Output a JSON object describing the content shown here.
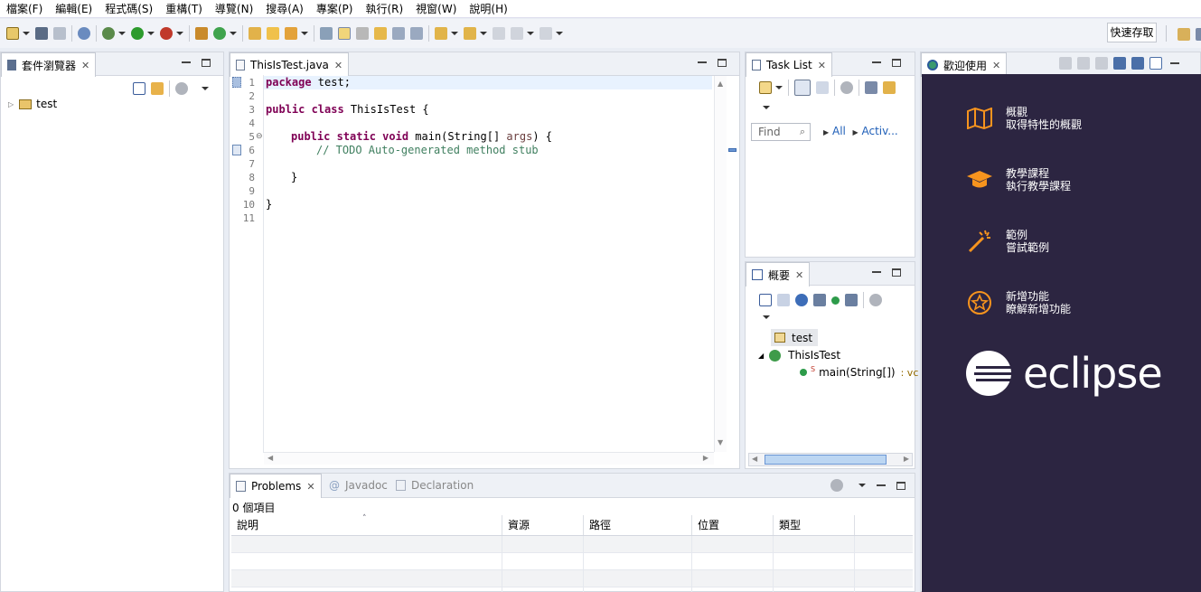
{
  "menu": [
    "檔案(F)",
    "編輯(E)",
    "程式碼(S)",
    "重構(T)",
    "導覽(N)",
    "搜尋(A)",
    "專案(P)",
    "執行(R)",
    "視窗(W)",
    "說明(H)"
  ],
  "toolbar": {
    "quick_access": "快速存取"
  },
  "package_explorer": {
    "title": "套件瀏覽器",
    "tree": [
      "test"
    ]
  },
  "editor": {
    "tab": "ThisIsTest.java",
    "lines": [
      "1",
      "2",
      "3",
      "4",
      "5",
      "6",
      "7",
      "8",
      "9",
      "10",
      "11"
    ],
    "code": {
      "l1_kw": "package",
      "l1_rest": " test;",
      "l3_kw": "public class",
      "l3_rest": " ThisIsTest {",
      "l5_kw": "public static void",
      "l5_rest": " main(String[] ",
      "l5_arg": "args",
      "l5_end": ") {",
      "l6_comment": "// TODO Auto-generated method stub",
      "l8": "}",
      "l10": "}"
    }
  },
  "task_list": {
    "title": "Task List",
    "find_placeholder": "Find",
    "all": "All",
    "activate": "Activ..."
  },
  "outline": {
    "title": "概要",
    "items": [
      "test",
      "ThisIsTest",
      "main(String[])",
      ": vc"
    ]
  },
  "welcome": {
    "title": "歡迎使用",
    "items": [
      {
        "title": "概觀",
        "desc": "取得特性的概觀",
        "icon": "map-icon"
      },
      {
        "title": "教學課程",
        "desc": "執行教學課程",
        "icon": "graduation-cap-icon"
      },
      {
        "title": "範例",
        "desc": "嘗試範例",
        "icon": "magic-wand-icon"
      },
      {
        "title": "新增功能",
        "desc": "瞭解新增功能",
        "icon": "star-icon"
      }
    ],
    "logo_text": "eclipse"
  },
  "bottom": {
    "tabs": [
      "Problems",
      "Javadoc",
      "Declaration"
    ],
    "summary": "0 個項目",
    "columns": [
      "說明",
      "資源",
      "路徑",
      "位置",
      "類型"
    ]
  },
  "colors": {
    "welcome_bg": "#2c2541",
    "accent": "#f7941e",
    "keyword": "#7f0055",
    "comment": "#3f7f5f"
  }
}
